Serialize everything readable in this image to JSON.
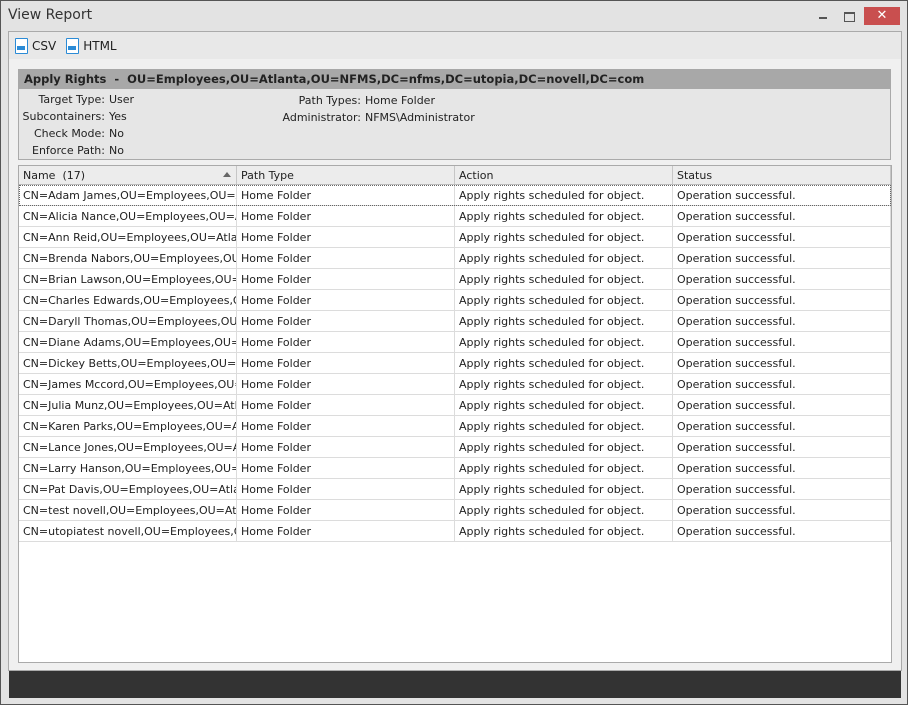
{
  "window": {
    "title": "View Report",
    "minimize": "–",
    "maximize": "□",
    "close": "✕"
  },
  "toolbar": {
    "csv": "CSV",
    "html": "HTML"
  },
  "report": {
    "header": "Apply Rights  -  OU=Employees,OU=Atlanta,OU=NFMS,DC=nfms,DC=utopia,DC=novell,DC=com",
    "fields_left": [
      {
        "k": "Target Type:",
        "v": "User"
      },
      {
        "k": "Subcontainers:",
        "v": "Yes"
      },
      {
        "k": "Check Mode:",
        "v": "No"
      },
      {
        "k": "Enforce Path:",
        "v": "No"
      }
    ],
    "fields_right": [
      {
        "k": "Path Types:",
        "v": "Home Folder"
      },
      {
        "k": "Administrator:",
        "v": "NFMS\\Administrator"
      }
    ]
  },
  "table": {
    "columns": [
      "Name  (17)",
      "Path Type",
      "Action",
      "Status"
    ],
    "rows": [
      [
        "CN=Adam James,OU=Employees,OU=At...",
        "Home Folder",
        "Apply rights scheduled for object.",
        "Operation successful."
      ],
      [
        "CN=Alicia Nance,OU=Employees,OU=Atl...",
        "Home Folder",
        "Apply rights scheduled for object.",
        "Operation successful."
      ],
      [
        "CN=Ann Reid,OU=Employees,OU=Atlan...",
        "Home Folder",
        "Apply rights scheduled for object.",
        "Operation successful."
      ],
      [
        "CN=Brenda Nabors,OU=Employees,OU=...",
        "Home Folder",
        "Apply rights scheduled for object.",
        "Operation successful."
      ],
      [
        "CN=Brian Lawson,OU=Employees,OU=A...",
        "Home Folder",
        "Apply rights scheduled for object.",
        "Operation successful."
      ],
      [
        "CN=Charles Edwards,OU=Employees,O...",
        "Home Folder",
        "Apply rights scheduled for object.",
        "Operation successful."
      ],
      [
        "CN=Daryll Thomas,OU=Employees,OU=...",
        "Home Folder",
        "Apply rights scheduled for object.",
        "Operation successful."
      ],
      [
        "CN=Diane Adams,OU=Employees,OU=A...",
        "Home Folder",
        "Apply rights scheduled for object.",
        "Operation successful."
      ],
      [
        "CN=Dickey Betts,OU=Employees,OU=At...",
        "Home Folder",
        "Apply rights scheduled for object.",
        "Operation successful."
      ],
      [
        "CN=James Mccord,OU=Employees,OU=...",
        "Home Folder",
        "Apply rights scheduled for object.",
        "Operation successful."
      ],
      [
        "CN=Julia Munz,OU=Employees,OU=Atla...",
        "Home Folder",
        "Apply rights scheduled for object.",
        "Operation successful."
      ],
      [
        "CN=Karen Parks,OU=Employees,OU=Atl...",
        "Home Folder",
        "Apply rights scheduled for object.",
        "Operation successful."
      ],
      [
        "CN=Lance Jones,OU=Employees,OU=At...",
        "Home Folder",
        "Apply rights scheduled for object.",
        "Operation successful."
      ],
      [
        "CN=Larry Hanson,OU=Employees,OU=A...",
        "Home Folder",
        "Apply rights scheduled for object.",
        "Operation successful."
      ],
      [
        "CN=Pat Davis,OU=Employees,OU=Atlan...",
        "Home Folder",
        "Apply rights scheduled for object.",
        "Operation successful."
      ],
      [
        "CN=test novell,OU=Employees,OU=Atla...",
        "Home Folder",
        "Apply rights scheduled for object.",
        "Operation successful."
      ],
      [
        "CN=utopiatest novell,OU=Employees,O...",
        "Home Folder",
        "Apply rights scheduled for object.",
        "Operation successful."
      ]
    ]
  }
}
